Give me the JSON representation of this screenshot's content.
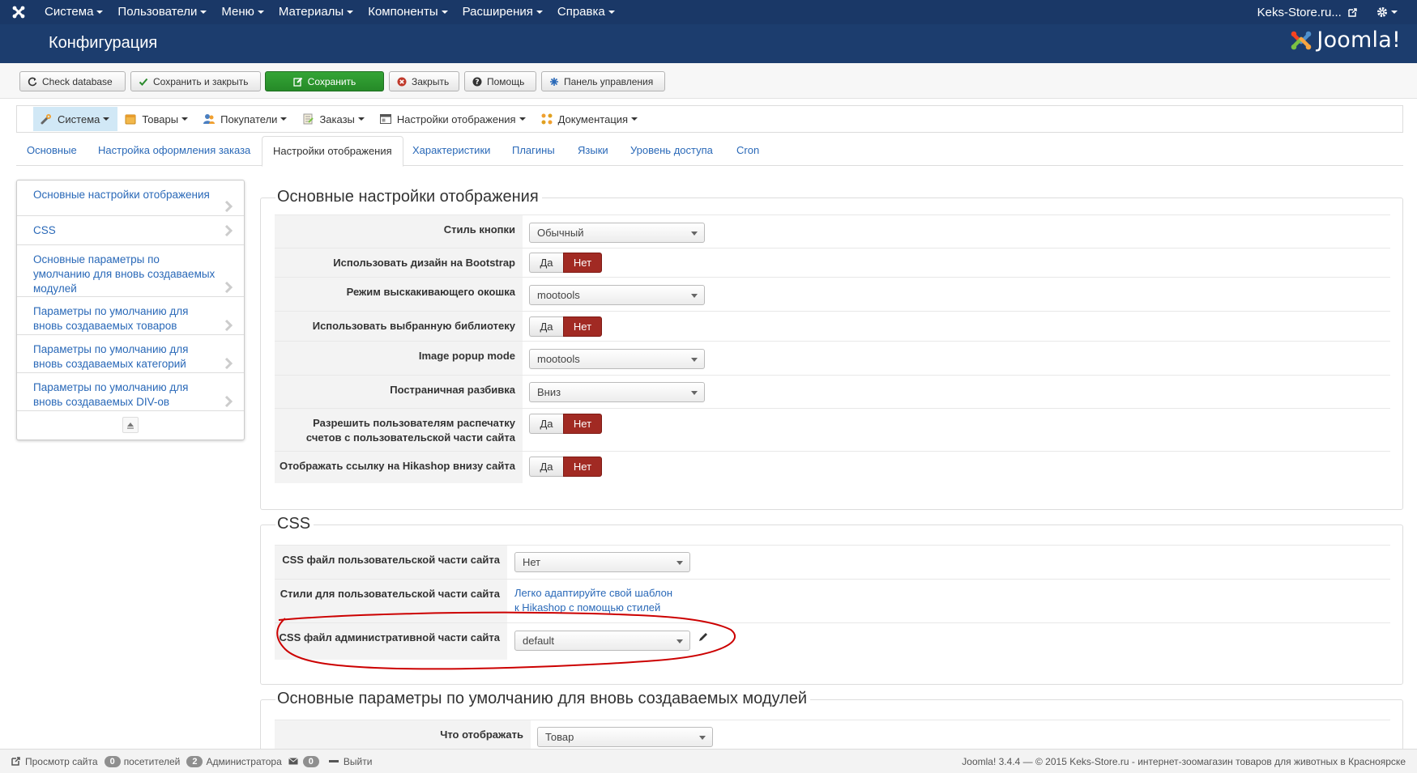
{
  "topnav": {
    "menu": [
      "Система",
      "Пользователи",
      "Меню",
      "Материалы",
      "Компоненты",
      "Расширения",
      "Справка"
    ],
    "site_link": "Keks-Store.ru..."
  },
  "header": {
    "title": "Конфигурация",
    "brand": "Joomla!"
  },
  "toolbar": {
    "check_database": "Check database",
    "save_close": "Сохранить и закрыть",
    "save": "Сохранить",
    "close": "Закрыть",
    "help": "Помощь",
    "control_panel": "Панель управления"
  },
  "hika_menu": [
    "Система",
    "Товары",
    "Покупатели",
    "Заказы",
    "Настройки отображения",
    "Документация"
  ],
  "tabs": [
    "Основные",
    "Настройка оформления заказа",
    "Настройки отображения",
    "Характеристики",
    "Плагины",
    "Языки",
    "Уровень доступа",
    "Cron"
  ],
  "active_tab": "Настройки отображения",
  "sidenav": [
    "Основные настройки отображения",
    "CSS",
    "Основные параметры по умолчанию для вновь создаваемых модулей",
    "Параметры по умолчанию для вновь создаваемых товаров",
    "Параметры по умолчанию для вновь создаваемых категорий",
    "Параметры по умолчанию для вновь создаваемых DIV-ов"
  ],
  "display_settings": {
    "legend": "Основные настройки отображения",
    "button_style": {
      "label": "Стиль кнопки",
      "value": "Обычный"
    },
    "use_bootstrap": {
      "label": "Использовать дизайн на Bootstrap",
      "yes": "Да",
      "no": "Нет",
      "selected": "Нет"
    },
    "popup_mode": {
      "label": "Режим выскакивающего окошка",
      "value": "mootools"
    },
    "use_library": {
      "label": "Использовать выбранную библиотеку",
      "yes": "Да",
      "no": "Нет",
      "selected": "Нет"
    },
    "image_popup": {
      "label": "Image popup mode",
      "value": "mootools"
    },
    "pagination": {
      "label": "Постраничная разбивка",
      "value": "Вниз"
    },
    "allow_print": {
      "label_1": "Разрешить пользователям распечатку",
      "label_2": "счетов с пользовательской части сайта",
      "yes": "Да",
      "no": "Нет",
      "selected": "Нет"
    },
    "hikashop_link": {
      "label": "Отображать ссылку на Hikashop внизу сайта",
      "yes": "Да",
      "no": "Нет",
      "selected": "Нет"
    }
  },
  "css_settings": {
    "legend": "CSS",
    "frontend_css": {
      "label": "CSS файл пользовательской части сайта",
      "value": "Нет"
    },
    "frontend_styles": {
      "label": "Стили для пользовательской части сайта",
      "link_1": "Легко адаптируйте свой шаблон",
      "link_2": "к Hikashop с помощью стилей"
    },
    "backend_css": {
      "label": "CSS файл административной части сайта",
      "value": "default"
    }
  },
  "module_settings": {
    "legend": "Основные параметры по умолчанию для вновь создаваемых модулей",
    "what_to_display": {
      "label": "Что отображать",
      "value": "Товар"
    }
  },
  "footer": {
    "view_site": "Просмотр сайта",
    "visitors_count": "0",
    "visitors_label": "посетителей",
    "admins_count": "2",
    "admins_label": "Администратора",
    "messages_count": "0",
    "logout": "Выйти",
    "copyright": "Joomla! 3.4.4  —  © 2015 Keks-Store.ru - интернет-зоомагазин товаров для животных в Красноярске"
  },
  "colors": {
    "navbar": "#1a3867",
    "header": "#1c3d6e",
    "link": "#2a69b8",
    "toggle_no": "#a12a23",
    "save_green": "#2e9a30",
    "annotation": "#cc0000"
  }
}
